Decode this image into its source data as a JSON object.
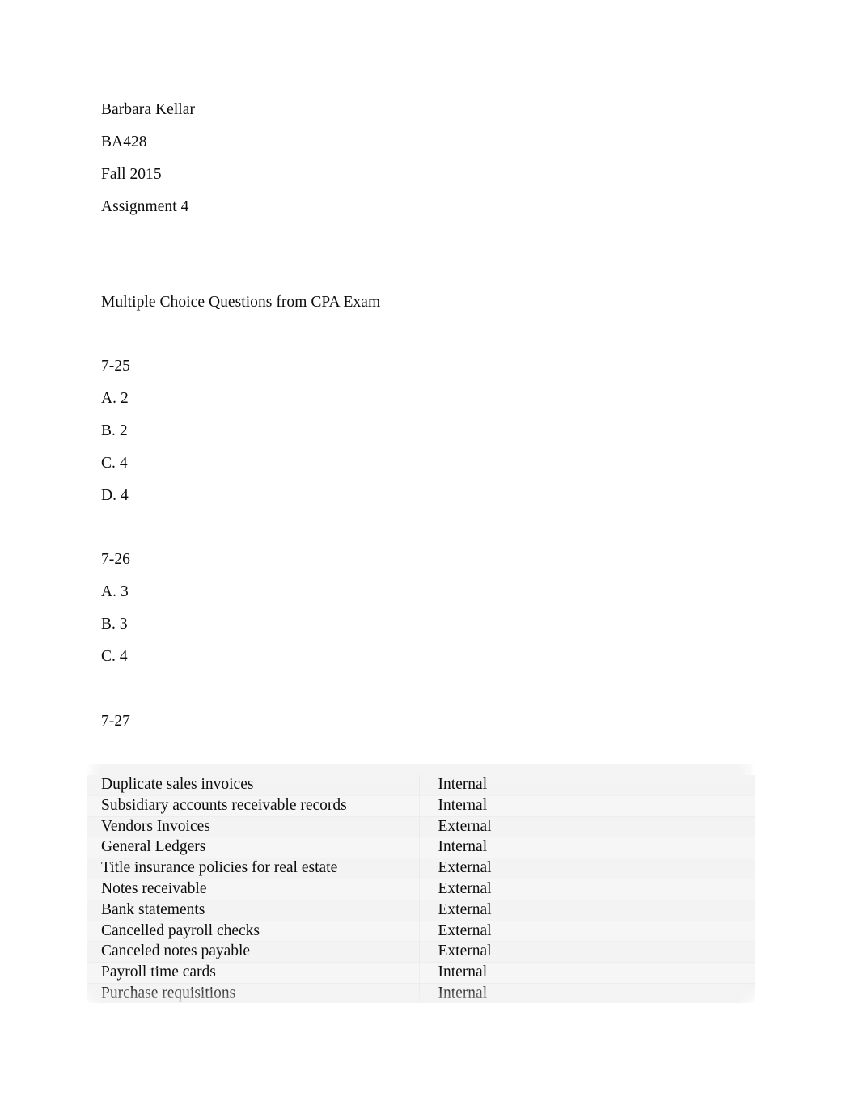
{
  "document": {
    "header": {
      "author": "Barbara Kellar",
      "course": "BA428",
      "term": "Fall 2015",
      "assignment": "Assignment 4"
    },
    "section_title": "Multiple Choice Questions from CPA Exam",
    "questions": [
      {
        "number": "7-25",
        "answers": [
          "A. 2",
          "B. 2",
          "C. 4",
          "D. 4"
        ]
      },
      {
        "number": "7-26",
        "answers": [
          "A. 3",
          "B. 3",
          "C. 4"
        ]
      },
      {
        "number": "7-27",
        "answers": []
      }
    ],
    "table": {
      "columns": [
        "",
        ""
      ],
      "rows": [
        {
          "document": "Duplicate sales invoices",
          "source": "Internal"
        },
        {
          "document": "Subsidiary accounts receivable records",
          "source": "Internal"
        },
        {
          "document": "Vendors Invoices",
          "source": "External"
        },
        {
          "document": "General Ledgers",
          "source": "Internal"
        },
        {
          "document": "Title insurance policies for real estate",
          "source": "External"
        },
        {
          "document": "Notes receivable",
          "source": "External"
        },
        {
          "document": "Bank statements",
          "source": "External"
        },
        {
          "document": "Cancelled payroll checks",
          "source": "External"
        },
        {
          "document": "Canceled notes payable",
          "source": "External"
        },
        {
          "document": "Payroll time cards",
          "source": "Internal"
        },
        {
          "document": "Purchase requisitions",
          "source": "Internal"
        }
      ]
    },
    "colors": {
      "page_background": "#ffffff",
      "text": "#0d0d0d",
      "table_shade_light": "#f6f6f6",
      "table_shade_dark": "#f3f3f3"
    }
  }
}
